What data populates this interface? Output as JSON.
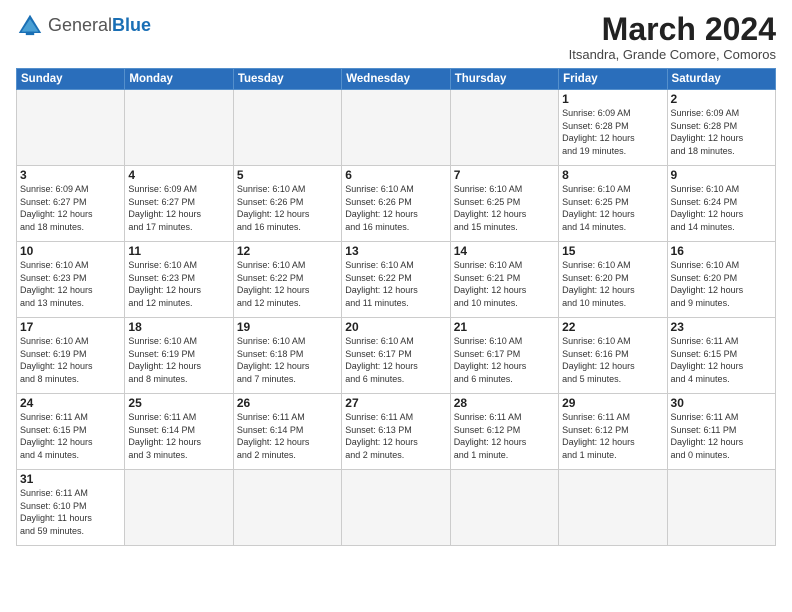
{
  "header": {
    "logo_general": "General",
    "logo_blue": "Blue",
    "month_title": "March 2024",
    "subtitle": "Itsandra, Grande Comore, Comoros"
  },
  "weekdays": [
    "Sunday",
    "Monday",
    "Tuesday",
    "Wednesday",
    "Thursday",
    "Friday",
    "Saturday"
  ],
  "weeks": [
    [
      {
        "date": "",
        "info": ""
      },
      {
        "date": "",
        "info": ""
      },
      {
        "date": "",
        "info": ""
      },
      {
        "date": "",
        "info": ""
      },
      {
        "date": "",
        "info": ""
      },
      {
        "date": "1",
        "info": "Sunrise: 6:09 AM\nSunset: 6:28 PM\nDaylight: 12 hours\nand 19 minutes."
      },
      {
        "date": "2",
        "info": "Sunrise: 6:09 AM\nSunset: 6:28 PM\nDaylight: 12 hours\nand 18 minutes."
      }
    ],
    [
      {
        "date": "3",
        "info": "Sunrise: 6:09 AM\nSunset: 6:27 PM\nDaylight: 12 hours\nand 18 minutes."
      },
      {
        "date": "4",
        "info": "Sunrise: 6:09 AM\nSunset: 6:27 PM\nDaylight: 12 hours\nand 17 minutes."
      },
      {
        "date": "5",
        "info": "Sunrise: 6:10 AM\nSunset: 6:26 PM\nDaylight: 12 hours\nand 16 minutes."
      },
      {
        "date": "6",
        "info": "Sunrise: 6:10 AM\nSunset: 6:26 PM\nDaylight: 12 hours\nand 16 minutes."
      },
      {
        "date": "7",
        "info": "Sunrise: 6:10 AM\nSunset: 6:25 PM\nDaylight: 12 hours\nand 15 minutes."
      },
      {
        "date": "8",
        "info": "Sunrise: 6:10 AM\nSunset: 6:25 PM\nDaylight: 12 hours\nand 14 minutes."
      },
      {
        "date": "9",
        "info": "Sunrise: 6:10 AM\nSunset: 6:24 PM\nDaylight: 12 hours\nand 14 minutes."
      }
    ],
    [
      {
        "date": "10",
        "info": "Sunrise: 6:10 AM\nSunset: 6:23 PM\nDaylight: 12 hours\nand 13 minutes."
      },
      {
        "date": "11",
        "info": "Sunrise: 6:10 AM\nSunset: 6:23 PM\nDaylight: 12 hours\nand 12 minutes."
      },
      {
        "date": "12",
        "info": "Sunrise: 6:10 AM\nSunset: 6:22 PM\nDaylight: 12 hours\nand 12 minutes."
      },
      {
        "date": "13",
        "info": "Sunrise: 6:10 AM\nSunset: 6:22 PM\nDaylight: 12 hours\nand 11 minutes."
      },
      {
        "date": "14",
        "info": "Sunrise: 6:10 AM\nSunset: 6:21 PM\nDaylight: 12 hours\nand 10 minutes."
      },
      {
        "date": "15",
        "info": "Sunrise: 6:10 AM\nSunset: 6:20 PM\nDaylight: 12 hours\nand 10 minutes."
      },
      {
        "date": "16",
        "info": "Sunrise: 6:10 AM\nSunset: 6:20 PM\nDaylight: 12 hours\nand 9 minutes."
      }
    ],
    [
      {
        "date": "17",
        "info": "Sunrise: 6:10 AM\nSunset: 6:19 PM\nDaylight: 12 hours\nand 8 minutes."
      },
      {
        "date": "18",
        "info": "Sunrise: 6:10 AM\nSunset: 6:19 PM\nDaylight: 12 hours\nand 8 minutes."
      },
      {
        "date": "19",
        "info": "Sunrise: 6:10 AM\nSunset: 6:18 PM\nDaylight: 12 hours\nand 7 minutes."
      },
      {
        "date": "20",
        "info": "Sunrise: 6:10 AM\nSunset: 6:17 PM\nDaylight: 12 hours\nand 6 minutes."
      },
      {
        "date": "21",
        "info": "Sunrise: 6:10 AM\nSunset: 6:17 PM\nDaylight: 12 hours\nand 6 minutes."
      },
      {
        "date": "22",
        "info": "Sunrise: 6:10 AM\nSunset: 6:16 PM\nDaylight: 12 hours\nand 5 minutes."
      },
      {
        "date": "23",
        "info": "Sunrise: 6:11 AM\nSunset: 6:15 PM\nDaylight: 12 hours\nand 4 minutes."
      }
    ],
    [
      {
        "date": "24",
        "info": "Sunrise: 6:11 AM\nSunset: 6:15 PM\nDaylight: 12 hours\nand 4 minutes."
      },
      {
        "date": "25",
        "info": "Sunrise: 6:11 AM\nSunset: 6:14 PM\nDaylight: 12 hours\nand 3 minutes."
      },
      {
        "date": "26",
        "info": "Sunrise: 6:11 AM\nSunset: 6:14 PM\nDaylight: 12 hours\nand 2 minutes."
      },
      {
        "date": "27",
        "info": "Sunrise: 6:11 AM\nSunset: 6:13 PM\nDaylight: 12 hours\nand 2 minutes."
      },
      {
        "date": "28",
        "info": "Sunrise: 6:11 AM\nSunset: 6:12 PM\nDaylight: 12 hours\nand 1 minute."
      },
      {
        "date": "29",
        "info": "Sunrise: 6:11 AM\nSunset: 6:12 PM\nDaylight: 12 hours\nand 1 minute."
      },
      {
        "date": "30",
        "info": "Sunrise: 6:11 AM\nSunset: 6:11 PM\nDaylight: 12 hours\nand 0 minutes."
      }
    ],
    [
      {
        "date": "31",
        "info": "Sunrise: 6:11 AM\nSunset: 6:10 PM\nDaylight: 11 hours\nand 59 minutes."
      },
      {
        "date": "",
        "info": ""
      },
      {
        "date": "",
        "info": ""
      },
      {
        "date": "",
        "info": ""
      },
      {
        "date": "",
        "info": ""
      },
      {
        "date": "",
        "info": ""
      },
      {
        "date": "",
        "info": ""
      }
    ]
  ]
}
